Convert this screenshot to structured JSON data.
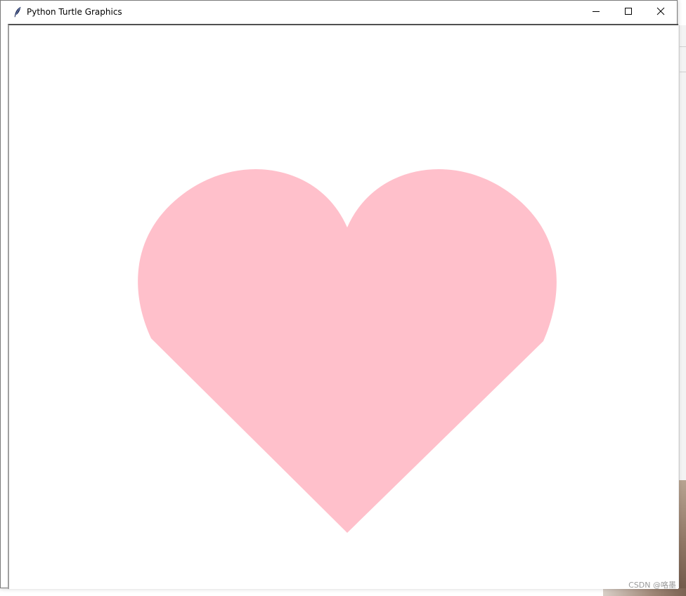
{
  "window": {
    "title": "Python Turtle Graphics",
    "icon": "feather-icon"
  },
  "caption_buttons": {
    "minimize_icon": "minimize-icon",
    "maximize_icon": "maximize-icon",
    "close_icon": "close-icon"
  },
  "canvas": {
    "background": "#ffffff",
    "heart_color": "#ffc0cb"
  },
  "watermark": {
    "text": "CSDN @咯墨"
  }
}
